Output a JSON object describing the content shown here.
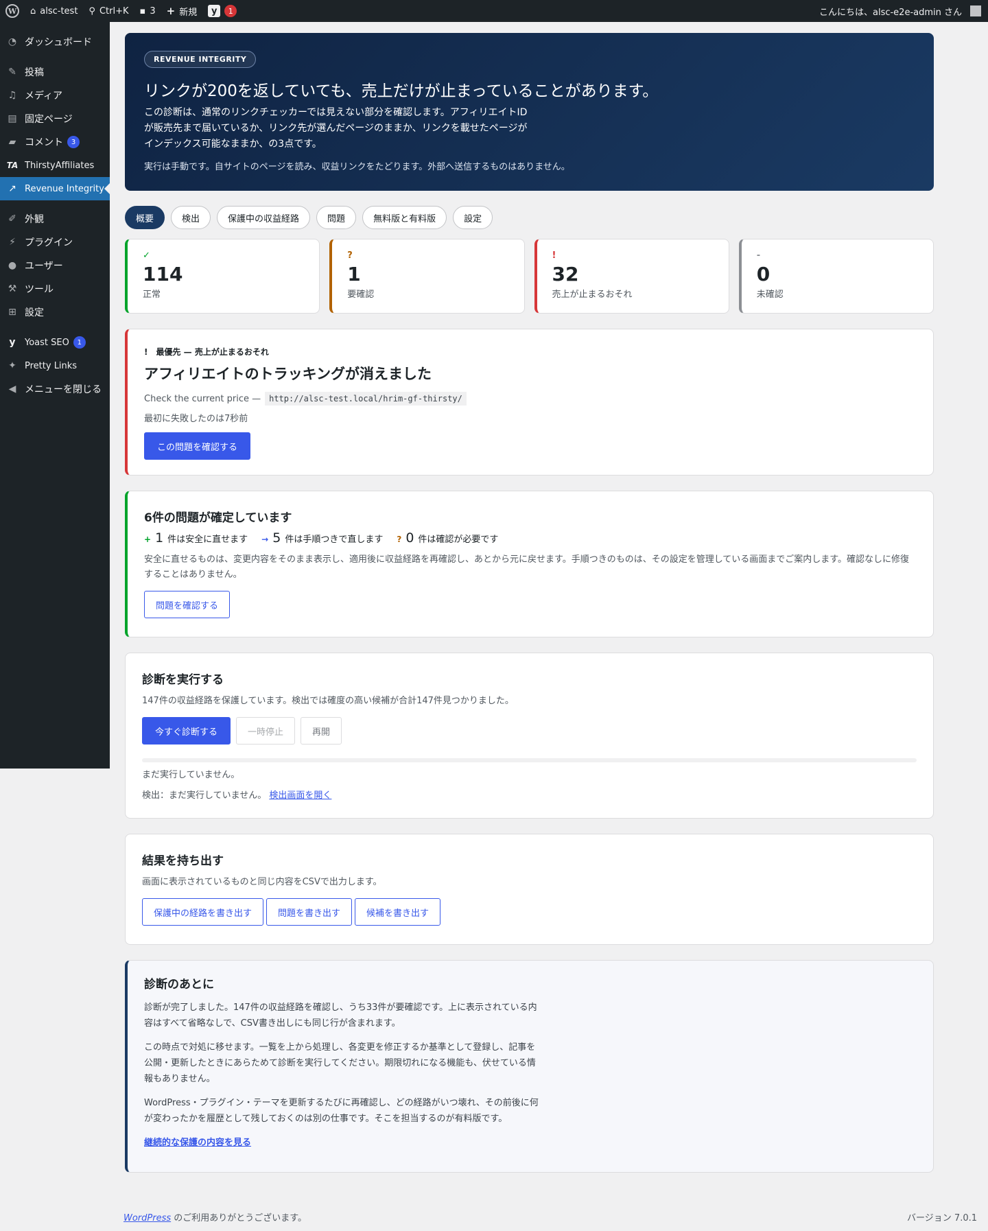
{
  "adminbar": {
    "site_name": "alsc-test",
    "search_shortcut": "Ctrl+K",
    "comments_count": "3",
    "new_label": "新規",
    "yoast_badge": "1",
    "greeting": "こんにちは、alsc-e2e-admin さん"
  },
  "sidebar": {
    "items": [
      {
        "label": "ダッシュボード",
        "icon": "dashboard-icon"
      },
      {
        "label": "投稿",
        "icon": "pin-icon"
      },
      {
        "label": "メディア",
        "icon": "media-icon"
      },
      {
        "label": "固定ページ",
        "icon": "page-icon"
      },
      {
        "label": "コメント",
        "icon": "comment-icon",
        "badge": "3"
      },
      {
        "label": "ThirstyAffiliates",
        "icon": "ta-icon"
      },
      {
        "label": "Revenue Integrity",
        "icon": "chart-icon"
      },
      {
        "label": "外観",
        "icon": "brush-icon"
      },
      {
        "label": "プラグイン",
        "icon": "plugin-icon"
      },
      {
        "label": "ユーザー",
        "icon": "user-icon"
      },
      {
        "label": "ツール",
        "icon": "wrench-icon"
      },
      {
        "label": "設定",
        "icon": "settings-icon"
      },
      {
        "label": "Yoast SEO",
        "icon": "yoast-icon",
        "badge": "1"
      },
      {
        "label": "Pretty Links",
        "icon": "star-icon"
      },
      {
        "label": "メニューを閉じる",
        "icon": "collapse-icon"
      }
    ]
  },
  "hero": {
    "tag": "REVENUE INTEGRITY",
    "title": "リンクが200を返していても、売上だけが止まっていることがあります。",
    "desc": "この診断は、通常のリンクチェッカーでは見えない部分を確認します。アフィリエイトIDが販売先まで届いているか、リンク先が選んだページのままか、リンクを載せたページがインデックス可能なままか、の3点です。",
    "note": "実行は手動です。自サイトのページを読み、収益リンクをたどります。外部へ送信するものはありません。"
  },
  "tabs": [
    "概要",
    "検出",
    "保護中の収益経路",
    "問題",
    "無料版と有料版",
    "設定"
  ],
  "stats": [
    {
      "icon": "✓",
      "num": "114",
      "label": "正常",
      "color": "#00a32a"
    },
    {
      "icon": "?",
      "num": "1",
      "label": "要確認",
      "color": "#b26200"
    },
    {
      "icon": "!",
      "num": "32",
      "label": "売上が止まるおそれ",
      "color": "#d63638"
    },
    {
      "icon": "-",
      "num": "0",
      "label": "未確認",
      "color": "#8c8f94"
    }
  ],
  "priority": {
    "label": "!　最優先 — 売上が止まるおそれ",
    "title": "アフィリエイトのトラッキングが消えました",
    "url_prefix": "Check the current price —",
    "url": "http://alsc-test.local/hrim-gf-thirsty/",
    "first_fail": "最初に失敗したのは7秒前",
    "button": "この問題を確認する"
  },
  "fixes": {
    "title": "6件の問題が確定しています",
    "safe_num": "1",
    "safe_label": "件は安全に直せます",
    "manual_num": "5",
    "manual_label": "件は手順つきで直します",
    "review_num": "0",
    "review_label": "件は確認が必要です",
    "desc": "安全に直せるものは、変更内容をそのまま表示し、適用後に収益経路を再確認し、あとから元に戻せます。手順つきのものは、その設定を管理している画面までご案内します。確認なしに修復することはありません。",
    "button": "問題を確認する"
  },
  "run": {
    "title": "診断を実行する",
    "desc": "147件の収益経路を保護しています。検出では確度の高い候補が合計147件見つかりました。",
    "run_button": "今すぐ診断する",
    "pause_button": "一時停止",
    "resume_button": "再開",
    "progress": 0,
    "status": "まだ実行していません。",
    "detect_status": "検出：まだ実行していません。",
    "detect_link": "検出画面を開く"
  },
  "export": {
    "title": "結果を持ち出す",
    "desc": "画面に表示されているものと同じ内容をCSVで出力します。",
    "buttons": [
      "保護中の経路を書き出す",
      "問題を書き出す",
      "候補を書き出す"
    ]
  },
  "after": {
    "title": "診断のあとに",
    "p1": "診断が完了しました。147件の収益経路を確認し、うち33件が要確認です。上に表示されている内容はすべて省略なしで、CSV書き出しにも同じ行が含まれます。",
    "p2": "この時点で対処に移せます。一覧を上から処理し、各変更を修正するか基準として登録し、記事を公開・更新したときにあらためて診断を実行してください。期限切れになる機能も、伏せている情報もありません。",
    "p3": "WordPress・プラグイン・テーマを更新するたびに再確認し、どの経路がいつ壊れ、その前後に何が変わったかを履歴として残しておくのは別の仕事です。そこを担当するのが有料版です。",
    "link": "継続的な保護の内容を見る"
  },
  "footer": {
    "wp_link": "WordPress",
    "thanks": " のご利用ありがとうございます。",
    "version": "バージョン 7.0.1"
  }
}
